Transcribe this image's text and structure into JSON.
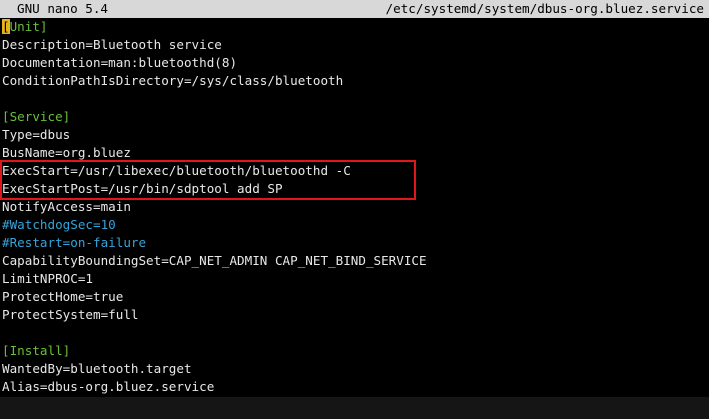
{
  "titlebar": {
    "app_name": "GNU nano 5.4",
    "file_path": "/etc/systemd/system/dbus-org.bluez.service"
  },
  "editor": {
    "cursor_char": "[",
    "unit_rest": "Unit]",
    "lines": [
      "Description=Bluetooth service",
      "Documentation=man:bluetoothd(8)",
      "ConditionPathIsDirectory=/sys/class/bluetooth",
      "",
      "[Service]",
      "Type=dbus",
      "BusName=org.bluez",
      "ExecStart=/usr/libexec/bluetooth/bluetoothd -C",
      "ExecStartPost=/usr/bin/sdptool add SP",
      "NotifyAccess=main",
      "#WatchdogSec=10",
      "#Restart=on-failure",
      "CapabilityBoundingSet=CAP_NET_ADMIN CAP_NET_BIND_SERVICE",
      "LimitNPROC=1",
      "ProtectHome=true",
      "ProtectSystem=full",
      "",
      "[Install]",
      "WantedBy=bluetooth.target",
      "Alias=dbus-org.bluez.service"
    ]
  },
  "colors": {
    "section_header": "#6abf3a",
    "comment": "#36a3d9",
    "cursor": "#e6b31e",
    "highlight_box": "#e0161d",
    "titlebar_bg": "#d8d8d8"
  }
}
